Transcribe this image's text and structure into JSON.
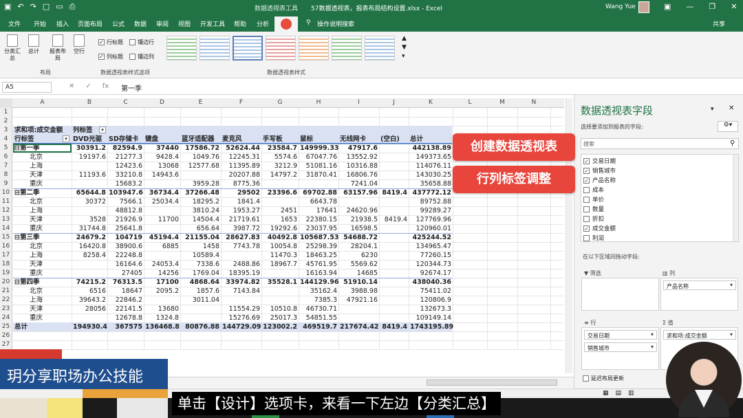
{
  "titlebar": {
    "context": "数据透视表工具",
    "title": "57数据透视表，报表布局结构设置.xlsx  -  Excel",
    "user": "Wang Yue"
  },
  "tabs": [
    "文件",
    "开始",
    "插入",
    "页面布局",
    "公式",
    "数据",
    "审阅",
    "视图",
    "开发工具",
    "帮助",
    "分析"
  ],
  "tab_help": "操作说明搜索",
  "tab_share": "共享",
  "ribbon": {
    "layout_buttons": [
      "分类汇总",
      "总计",
      "报表布局",
      "空行"
    ],
    "layout_group": "布局",
    "options": [
      {
        "label": "行标题",
        "checked": true
      },
      {
        "label": "镶边行",
        "checked": false
      },
      {
        "label": "列标题",
        "checked": true
      },
      {
        "label": "镶边列",
        "checked": false
      }
    ],
    "options_group": "数据透视表样式选项",
    "styles_group": "数据透视表样式"
  },
  "formula": {
    "namebox": "A5",
    "value": "第一季"
  },
  "columns": [
    "A",
    "B",
    "C",
    "D",
    "E",
    "F",
    "G",
    "H",
    "I",
    "J",
    "K",
    "L",
    "M",
    "N"
  ],
  "header_rows": {
    "r3": [
      "求和项:成交金额",
      "列标签"
    ],
    "r4": [
      "行标签",
      "DVD光驱",
      "SD存储卡",
      "键盘",
      "蓝牙适配器",
      "麦克风",
      "手写板",
      "鼠标",
      "无线网卡",
      "(空白)",
      "总计"
    ]
  },
  "rows": [
    {
      "n": 5,
      "t": "q",
      "label": "⊟第一季",
      "v": [
        "30391.2",
        "82594.9",
        "37440",
        "17586.72",
        "52624.44",
        "23584.7",
        "149999.33",
        "47917.6",
        "",
        "442138.89"
      ]
    },
    {
      "n": 6,
      "t": "c",
      "label": "北京",
      "v": [
        "19197.6",
        "21277.3",
        "9428.4",
        "1049.76",
        "12245.31",
        "5574.6",
        "67047.76",
        "13552.92",
        "",
        "149373.65"
      ]
    },
    {
      "n": 7,
      "t": "c",
      "label": "上海",
      "v": [
        "",
        "12423.6",
        "13068",
        "12577.68",
        "11395.89",
        "3212.9",
        "51081.16",
        "10316.88",
        "",
        "114076.11"
      ]
    },
    {
      "n": 8,
      "t": "c",
      "label": "天津",
      "v": [
        "11193.6",
        "33210.8",
        "14943.6",
        "",
        "20207.88",
        "14797.2",
        "31870.41",
        "16806.76",
        "",
        "143030.25"
      ]
    },
    {
      "n": 9,
      "t": "c",
      "label": "重庆",
      "v": [
        "",
        "15683.2",
        "",
        "3959.28",
        "8775.36",
        "",
        "",
        "7241.04",
        "",
        "35658.88"
      ]
    },
    {
      "n": 10,
      "t": "q",
      "label": "⊟第二季",
      "v": [
        "65644.8",
        "103947.6",
        "36734.4",
        "37266.48",
        "29502",
        "23396.6",
        "69702.88",
        "63157.96",
        "8419.4",
        "437772.12"
      ]
    },
    {
      "n": 11,
      "t": "c",
      "label": "北京",
      "v": [
        "30372",
        "7566.1",
        "25034.4",
        "18295.2",
        "1841.4",
        "",
        "6643.78",
        "",
        "",
        "89752.88"
      ]
    },
    {
      "n": 12,
      "t": "c",
      "label": "上海",
      "v": [
        "",
        "48812.8",
        "",
        "3810.24",
        "1953.27",
        "2451",
        "17641",
        "24620.96",
        "",
        "99289.27"
      ]
    },
    {
      "n": 13,
      "t": "c",
      "label": "天津",
      "v": [
        "3528",
        "21926.9",
        "11700",
        "14504.4",
        "21719.61",
        "1653",
        "22380.15",
        "21938.5",
        "8419.4",
        "127769.96"
      ]
    },
    {
      "n": 14,
      "t": "c",
      "label": "重庆",
      "v": [
        "31744.8",
        "25641.8",
        "",
        "656.64",
        "3987.72",
        "19292.6",
        "23037.95",
        "16598.5",
        "",
        "120960.01"
      ]
    },
    {
      "n": 15,
      "t": "q",
      "label": "⊟第三季",
      "v": [
        "24679.2",
        "104719",
        "45194.4",
        "21155.04",
        "28627.83",
        "40492.8",
        "105687.53",
        "54688.72",
        "",
        "425244.52"
      ]
    },
    {
      "n": 16,
      "t": "c",
      "label": "北京",
      "v": [
        "16420.8",
        "38900.6",
        "6885",
        "1458",
        "7743.78",
        "10054.8",
        "25298.39",
        "28204.1",
        "",
        "134965.47"
      ]
    },
    {
      "n": 17,
      "t": "c",
      "label": "上海",
      "v": [
        "8258.4",
        "22248.8",
        "",
        "10589.4",
        "",
        "11470.3",
        "18463.25",
        "6230",
        "",
        "77260.15"
      ]
    },
    {
      "n": 18,
      "t": "c",
      "label": "天津",
      "v": [
        "",
        "16164.6",
        "24053.4",
        "7338.6",
        "2488.86",
        "18967.7",
        "45761.95",
        "5569.62",
        "",
        "120344.73"
      ]
    },
    {
      "n": 19,
      "t": "c",
      "label": "重庆",
      "v": [
        "",
        "27405",
        "14256",
        "1769.04",
        "18395.19",
        "",
        "16163.94",
        "14685",
        "",
        "92674.17"
      ]
    },
    {
      "n": 20,
      "t": "q",
      "label": "⊟第四季",
      "v": [
        "74215.2",
        "76313.5",
        "17100",
        "4868.64",
        "33974.82",
        "35528.1",
        "144129.96",
        "51910.14",
        "",
        "438040.36"
      ]
    },
    {
      "n": 21,
      "t": "c",
      "label": "北京",
      "v": [
        "6516",
        "18647",
        "2095.2",
        "1857.6",
        "7143.84",
        "",
        "35162.4",
        "3988.98",
        "",
        "75411.02"
      ]
    },
    {
      "n": 22,
      "t": "c",
      "label": "上海",
      "v": [
        "39643.2",
        "22846.2",
        "",
        "3011.04",
        "",
        "",
        "7385.3",
        "47921.16",
        "",
        "120806.9"
      ]
    },
    {
      "n": 23,
      "t": "c",
      "label": "天津",
      "v": [
        "28056",
        "22141.5",
        "13680",
        "",
        "11554.29",
        "10510.8",
        "46730.71",
        "",
        "",
        "132673.3"
      ]
    },
    {
      "n": 24,
      "t": "c",
      "label": "重庆",
      "v": [
        "",
        "12678.8",
        "1324.8",
        "",
        "15276.69",
        "25017.3",
        "54851.55",
        "",
        "",
        "109149.14"
      ]
    },
    {
      "n": 25,
      "t": "g",
      "label": "总计",
      "v": [
        "194930.4",
        "367575",
        "136468.8",
        "80876.88",
        "144729.09",
        "123002.2",
        "469519.7",
        "217674.42",
        "8419.4",
        "1743195.89"
      ]
    }
  ],
  "empty_rows": [
    1,
    2,
    26,
    27
  ],
  "panel": {
    "title": "数据透视表字段",
    "subtitle": "选择要添加到报表的字段:",
    "search": "搜索",
    "fields": [
      {
        "label": "交易日期",
        "checked": true
      },
      {
        "label": "销售城市",
        "checked": true
      },
      {
        "label": "产品名称",
        "checked": true
      },
      {
        "label": "成本",
        "checked": false
      },
      {
        "label": "单价",
        "checked": false
      },
      {
        "label": "数量",
        "checked": false
      },
      {
        "label": "折扣",
        "checked": false
      },
      {
        "label": "成交金额",
        "checked": true
      },
      {
        "label": "利润",
        "checked": false
      }
    ],
    "drag_hint": "在以下区域间拖动字段:",
    "filter_label": "筛选",
    "columns_label": "列",
    "rows_label": "行",
    "values_label": "值",
    "columns_items": [
      "产品名称"
    ],
    "rows_items": [
      "交易日期",
      "销售城市"
    ],
    "values_items": [
      "求和项:成交金额"
    ],
    "defer": "延迟布局更新"
  },
  "callouts": [
    "创建数据透视表",
    "行列标签调整"
  ],
  "brand": "玥分享职场办公技能",
  "subtitle": "单击【设计】选项卡，来看一下左边【分类汇总】",
  "colors": {
    "excel_green": "#217346",
    "callout_red": "#e8453c",
    "brand_blue": "#1f4e8f",
    "pivot_header": "#d9e1f2"
  }
}
